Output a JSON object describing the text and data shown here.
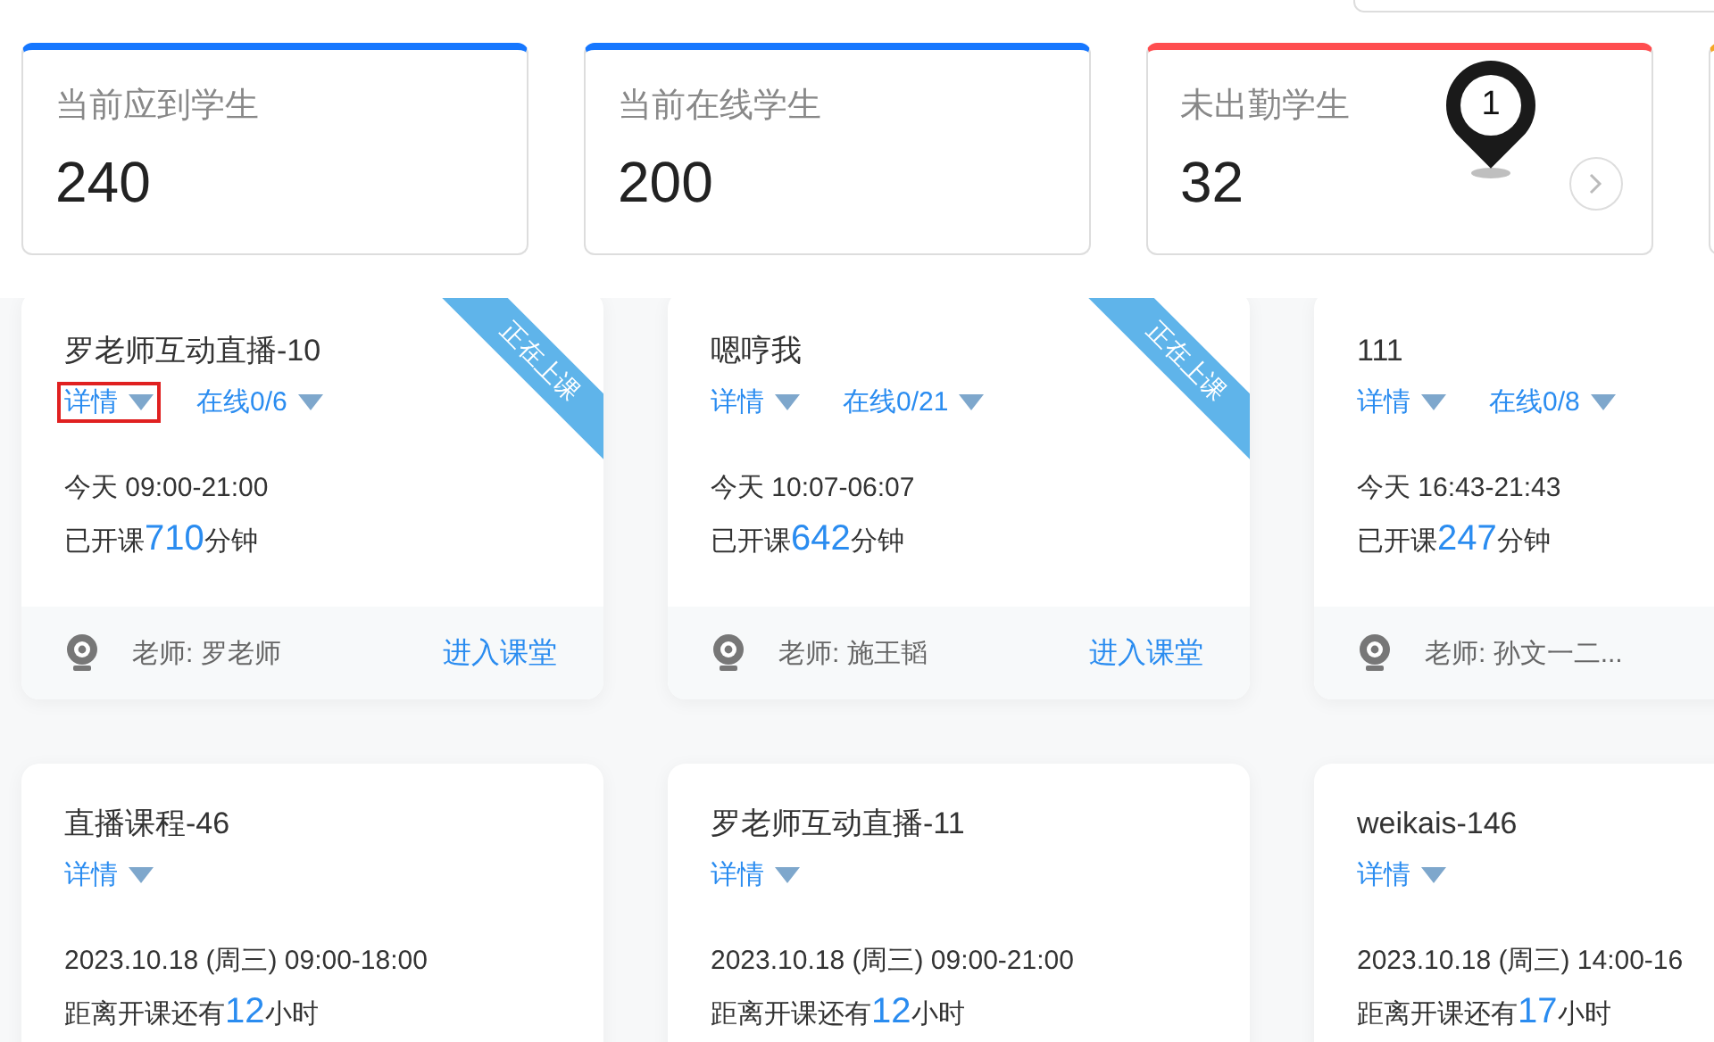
{
  "stats": [
    {
      "label": "当前应到学生",
      "value": "240",
      "color": "#1677ff",
      "arrow": false
    },
    {
      "label": "当前在线学生",
      "value": "200",
      "color": "#1677ff",
      "arrow": false
    },
    {
      "label": "未出勤学生",
      "value": "32",
      "color": "#ff4d4f",
      "arrow": true
    },
    {
      "color": "#f5a623",
      "arrow": false
    }
  ],
  "marker": {
    "label": "1"
  },
  "courses": [
    {
      "title": "罗老师互动直播-10",
      "detail": {
        "label": "详情",
        "highlighted": true
      },
      "online": "在线0/6",
      "time": "今天 09:00-21:00",
      "elapsed": {
        "prefix": "已开课",
        "number": "710",
        "suffix": "分钟"
      },
      "teacher": "老师: 罗老师",
      "enter": "进入课堂",
      "live": true,
      "ribbon": "正在上课"
    },
    {
      "title": "嗯哼我",
      "detail": {
        "label": "详情",
        "highlighted": false
      },
      "online": "在线0/21",
      "time": "今天 10:07-06:07",
      "elapsed": {
        "prefix": "已开课",
        "number": "642",
        "suffix": "分钟"
      },
      "teacher": "老师: 施王韬",
      "enter": "进入课堂",
      "live": true,
      "ribbon": "正在上课"
    },
    {
      "title": "111",
      "detail": {
        "label": "详情",
        "highlighted": false
      },
      "online": "在线0/8",
      "time": "今天 16:43-21:43",
      "elapsed": {
        "prefix": "已开课",
        "number": "247",
        "suffix": "分钟"
      },
      "teacher": "老师: 孙文一二...",
      "live": false
    },
    {
      "title": "直播课程-46",
      "detail": {
        "label": "详情",
        "highlighted": false
      },
      "time": "2023.10.18 (周三) 09:00-18:00",
      "elapsed": {
        "prefix": "距离开课还有",
        "number": "12",
        "suffix": "小时"
      },
      "live": false
    },
    {
      "title": "罗老师互动直播-11",
      "detail": {
        "label": "详情",
        "highlighted": false
      },
      "time": "2023.10.18 (周三) 09:00-21:00",
      "elapsed": {
        "prefix": "距离开课还有",
        "number": "12",
        "suffix": "小时"
      },
      "live": false
    },
    {
      "title": "weikais-146",
      "detail": {
        "label": "详情",
        "highlighted": false
      },
      "time": "2023.10.18 (周三) 14:00-16",
      "elapsed": {
        "prefix": "距离开课还有",
        "number": "17",
        "suffix": "小时"
      },
      "live": false
    }
  ]
}
